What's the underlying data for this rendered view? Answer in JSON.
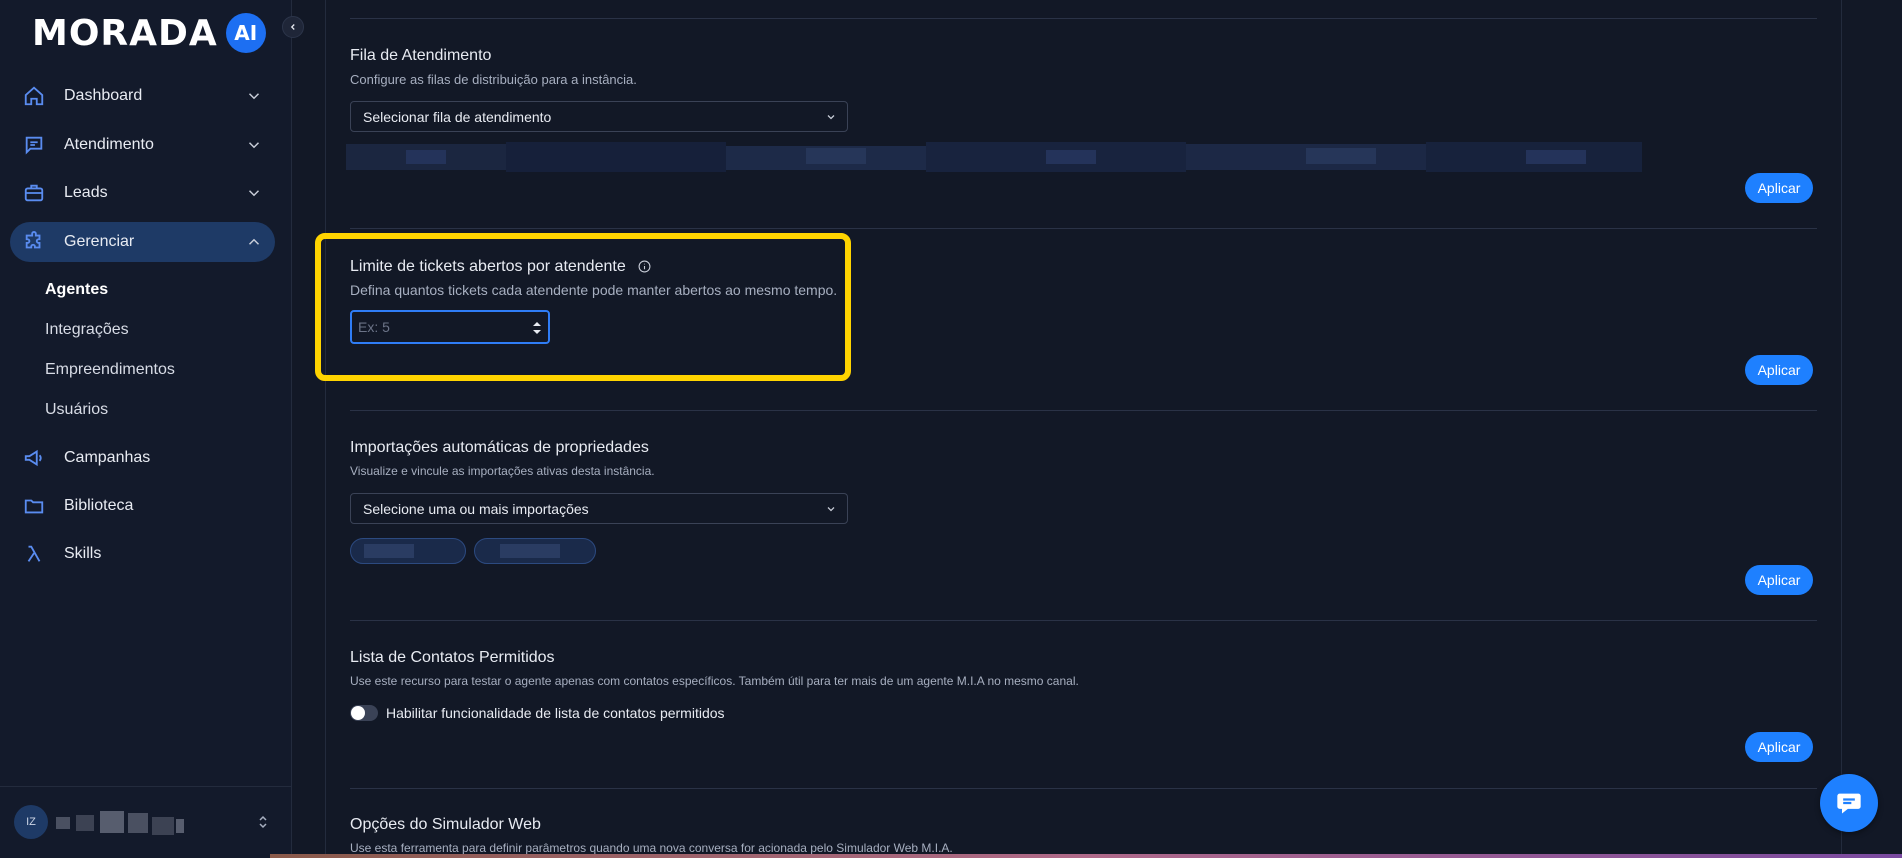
{
  "brand": {
    "name": "MORADA",
    "badge": "AI"
  },
  "sidebar": {
    "items": [
      {
        "label": "Dashboard",
        "icon": "home-icon"
      },
      {
        "label": "Atendimento",
        "icon": "chat-icon"
      },
      {
        "label": "Leads",
        "icon": "briefcase-icon"
      },
      {
        "label": "Gerenciar",
        "icon": "puzzle-icon",
        "expanded": true
      },
      {
        "label": "Campanhas",
        "icon": "megaphone-icon"
      },
      {
        "label": "Biblioteca",
        "icon": "folder-icon"
      },
      {
        "label": "Skills",
        "icon": "lambda-icon"
      }
    ],
    "submenu": [
      "Agentes",
      "Integrações",
      "Empreendimentos",
      "Usuários"
    ],
    "user": {
      "initials": "IZ"
    }
  },
  "sections": {
    "fila": {
      "title": "Fila de Atendimento",
      "desc": "Configure as filas de distribuição para a instância.",
      "select": "Selecionar fila de atendimento",
      "apply": "Aplicar"
    },
    "limite": {
      "title": "Limite de tickets abertos por atendente",
      "desc": "Defina quantos tickets cada atendente pode manter abertos ao mesmo tempo.",
      "placeholder": "Ex: 5",
      "apply": "Aplicar"
    },
    "importacoes": {
      "title": "Importações automáticas de propriedades",
      "desc": "Visualize e vincule as importações ativas desta instância.",
      "select": "Selecione uma ou mais importações",
      "apply": "Aplicar"
    },
    "contatos": {
      "title": "Lista de Contatos Permitidos",
      "desc": "Use este recurso para testar o agente apenas com contatos específicos. Também útil para ter mais de um agente M.I.A no mesmo canal.",
      "toggle_label": "Habilitar funcionalidade de lista de contatos permitidos",
      "apply": "Aplicar"
    },
    "simulador": {
      "title": "Opções do Simulador Web",
      "desc": "Use esta ferramenta para definir parâmetros quando uma nova conversa for acionada pelo Simulador Web M.I.A."
    }
  },
  "colors": {
    "accent": "#1e80ff",
    "highlight": "#ffd400",
    "background": "#121826"
  }
}
